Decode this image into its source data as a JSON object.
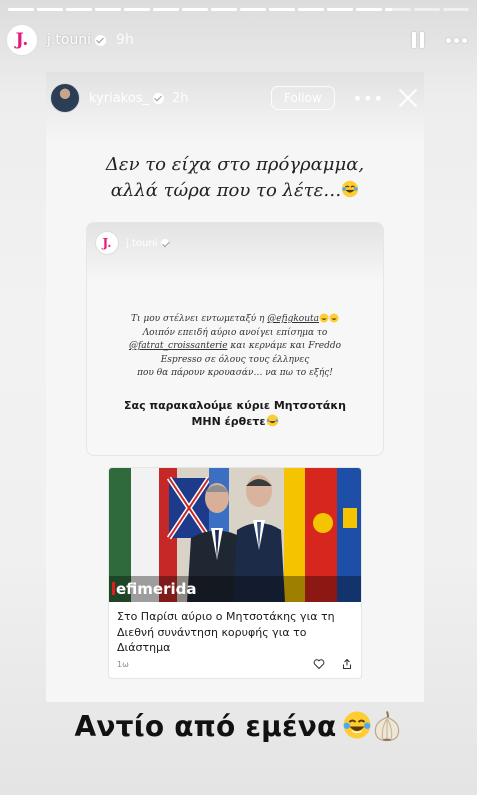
{
  "progress": {
    "segments_total": 16,
    "completed": 13,
    "current_fraction": 0.25
  },
  "outer_story": {
    "username": "j.touni",
    "time": "9h",
    "avatar_letter": "J."
  },
  "inner_story": {
    "username": "kyriakos_",
    "time": "2h",
    "follow_label": "Follow",
    "more_label": "•••"
  },
  "caption": {
    "line1": "Δεν το είχα στο πρόγραμμα,",
    "line2": "αλλά τώρα που το λέτε…"
  },
  "nested_story": {
    "username": "j.touni",
    "avatar_letter": "J.",
    "text_l1_a": "Τι μου στέλνει εντωμεταξύ η ",
    "text_l1_mention": "@efigkouta",
    "text_l2": "Λοιπόν επειδή αύριο ανοίγει επίσημα το",
    "text_l3_mention": "@fatrat_croissanterie",
    "text_l3_b": " και κερνάμε και Freddo",
    "text_l4": "Espresso σε όλους τους έλληνες",
    "text_l5": "που θα πάρουν κρουασάν… να πω το εξής!",
    "bold_l1": "Σας παρακαλούμε κύριε Μητσοτάκη",
    "bold_l2": "ΜΗΝ έρθετε"
  },
  "news_card": {
    "brand": "efimerida",
    "title": "Στο Παρίσι αύριο ο Μητσοτάκης για τη Διεθνή συνάντηση κορυφής για το Διάστημα",
    "age": "1ω"
  },
  "footer_caption": "Αντίο από εμένα",
  "icons": {
    "pause": "pause-icon",
    "more": "more-icon",
    "close": "close-icon",
    "verified": "verified-badge-icon",
    "heart": "heart-icon",
    "share": "share-icon",
    "emoji_laugh": "tears-of-joy-emoji",
    "emoji_garlic": "garlic-emoji"
  },
  "colors": {
    "brand_pink": "#e6167a",
    "efimerida_red": "#e21b1b"
  }
}
